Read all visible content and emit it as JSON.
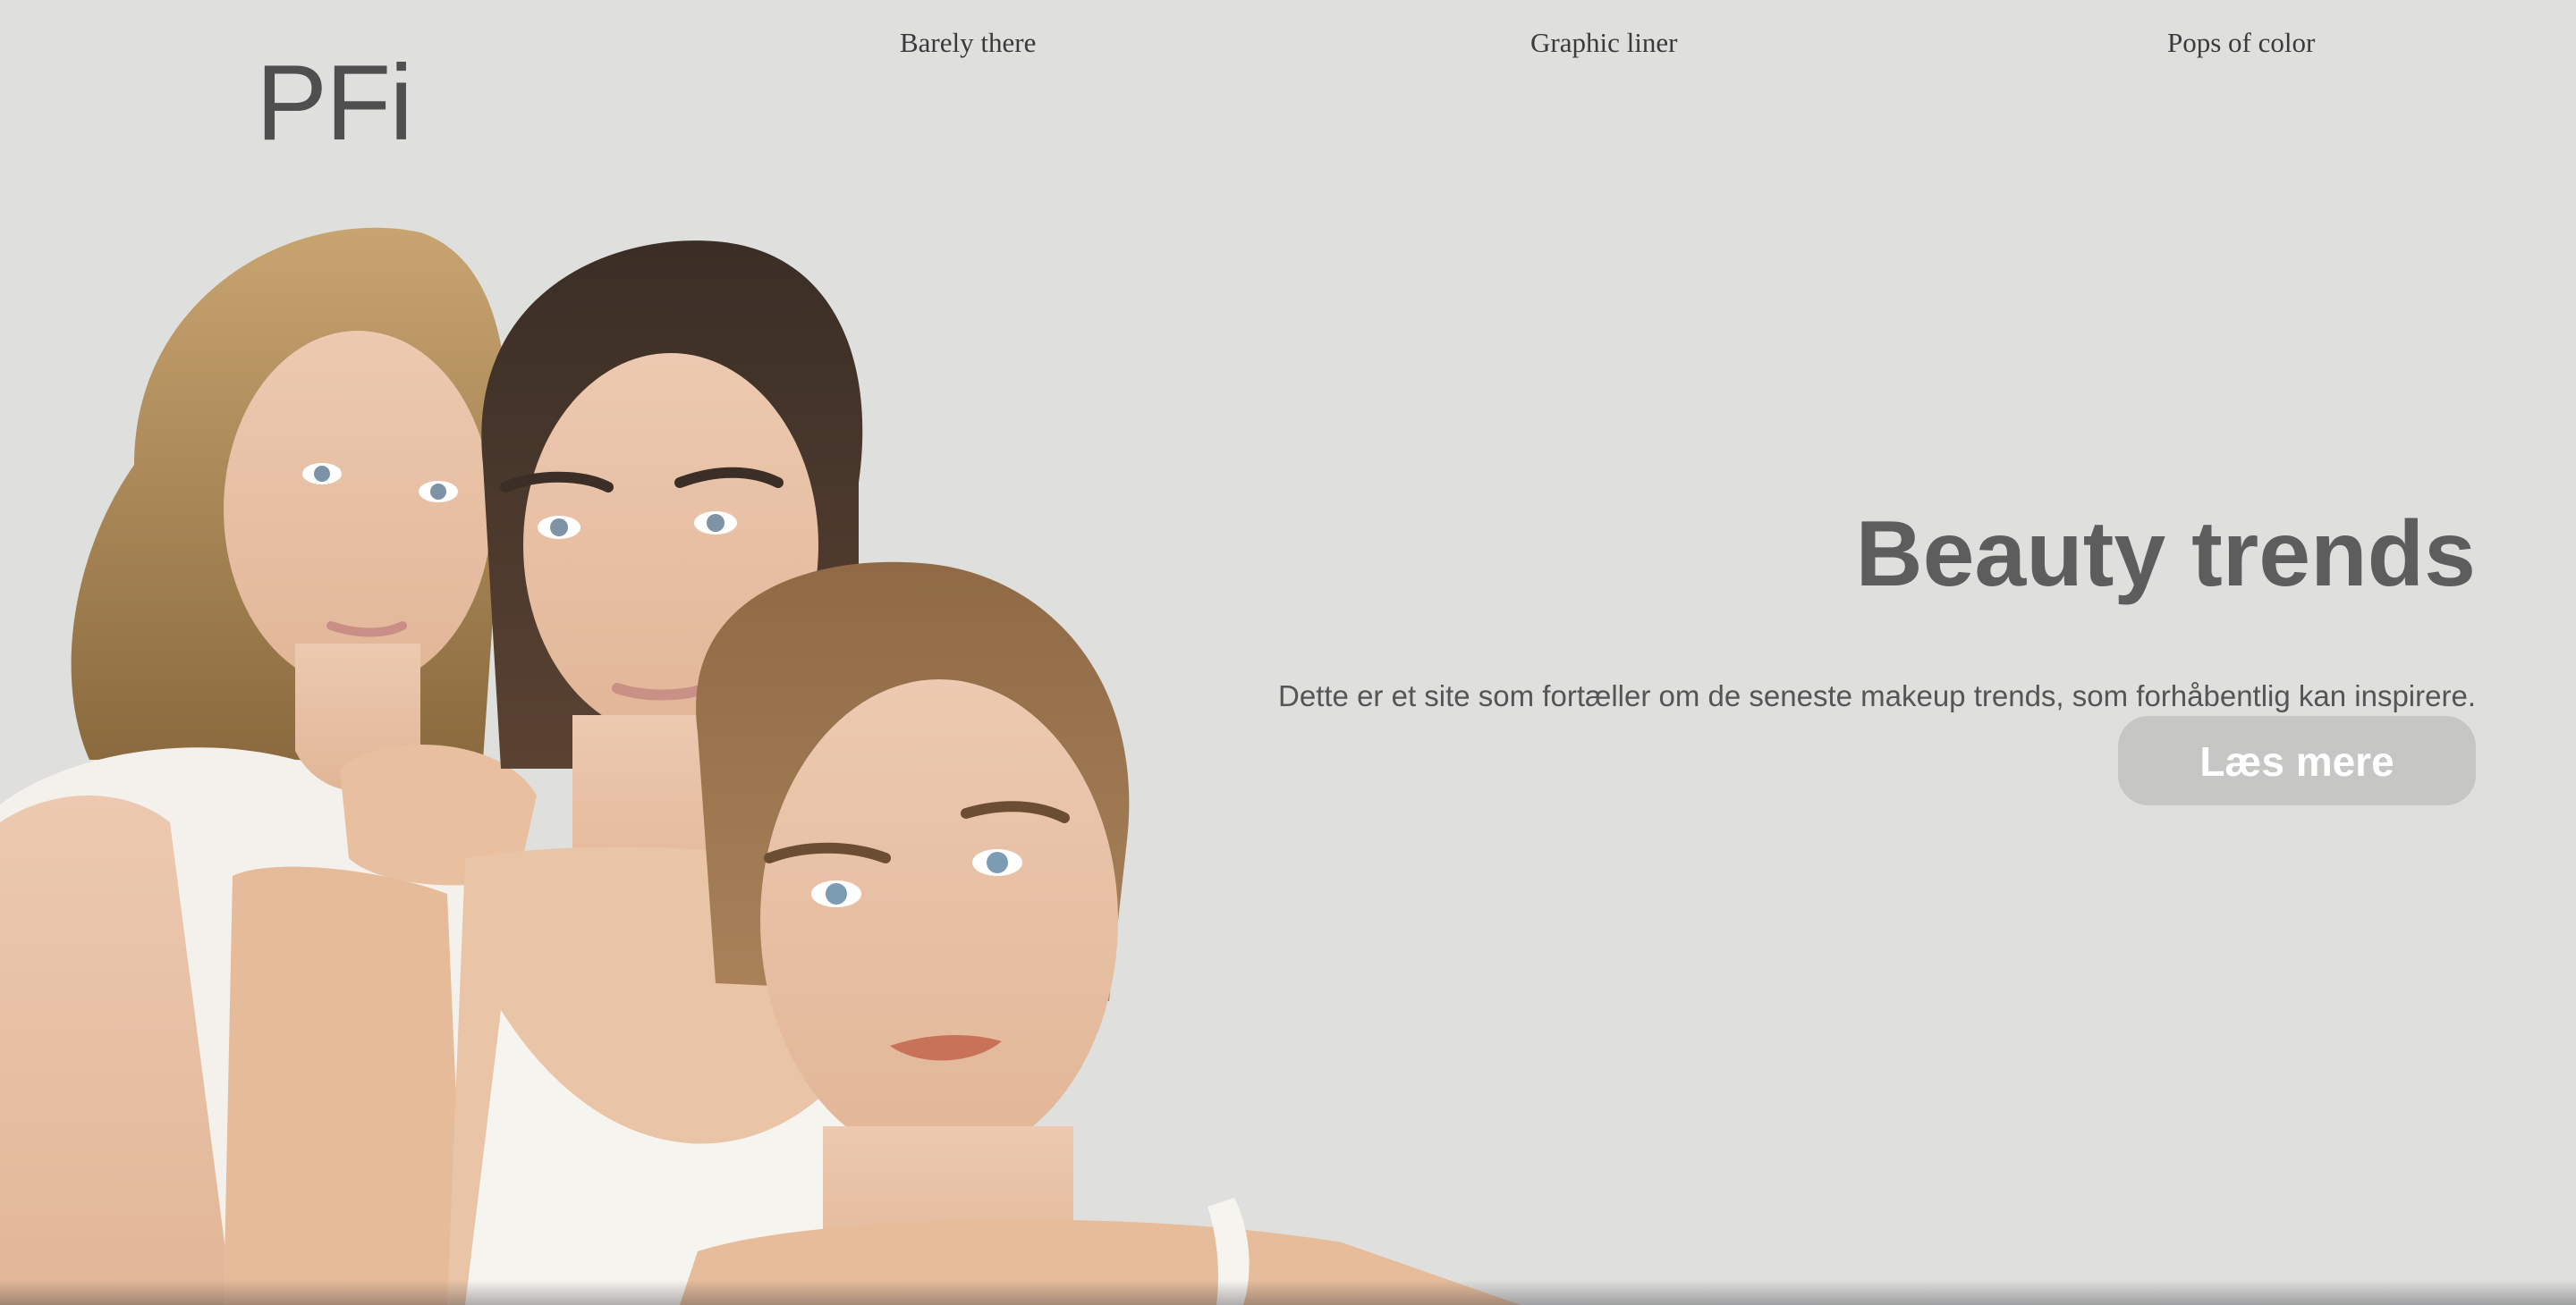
{
  "brand": {
    "logo_text": "PFi"
  },
  "nav": {
    "items": [
      {
        "label": "Barely there"
      },
      {
        "label": "Graphic liner"
      },
      {
        "label": "Pops of color"
      }
    ]
  },
  "hero": {
    "title": "Beauty trends",
    "description": "Dette er et site som fortæller om de seneste makeup trends, som forhåbentlig kan inspirere.",
    "cta_label": "Læs mere",
    "image_subject": "three-models-portrait"
  },
  "colors": {
    "background": "#dfdfdd",
    "title": "#5d5d5d",
    "text": "#555555",
    "button_bg": "#c6c6c4",
    "button_text": "#ffffff"
  }
}
